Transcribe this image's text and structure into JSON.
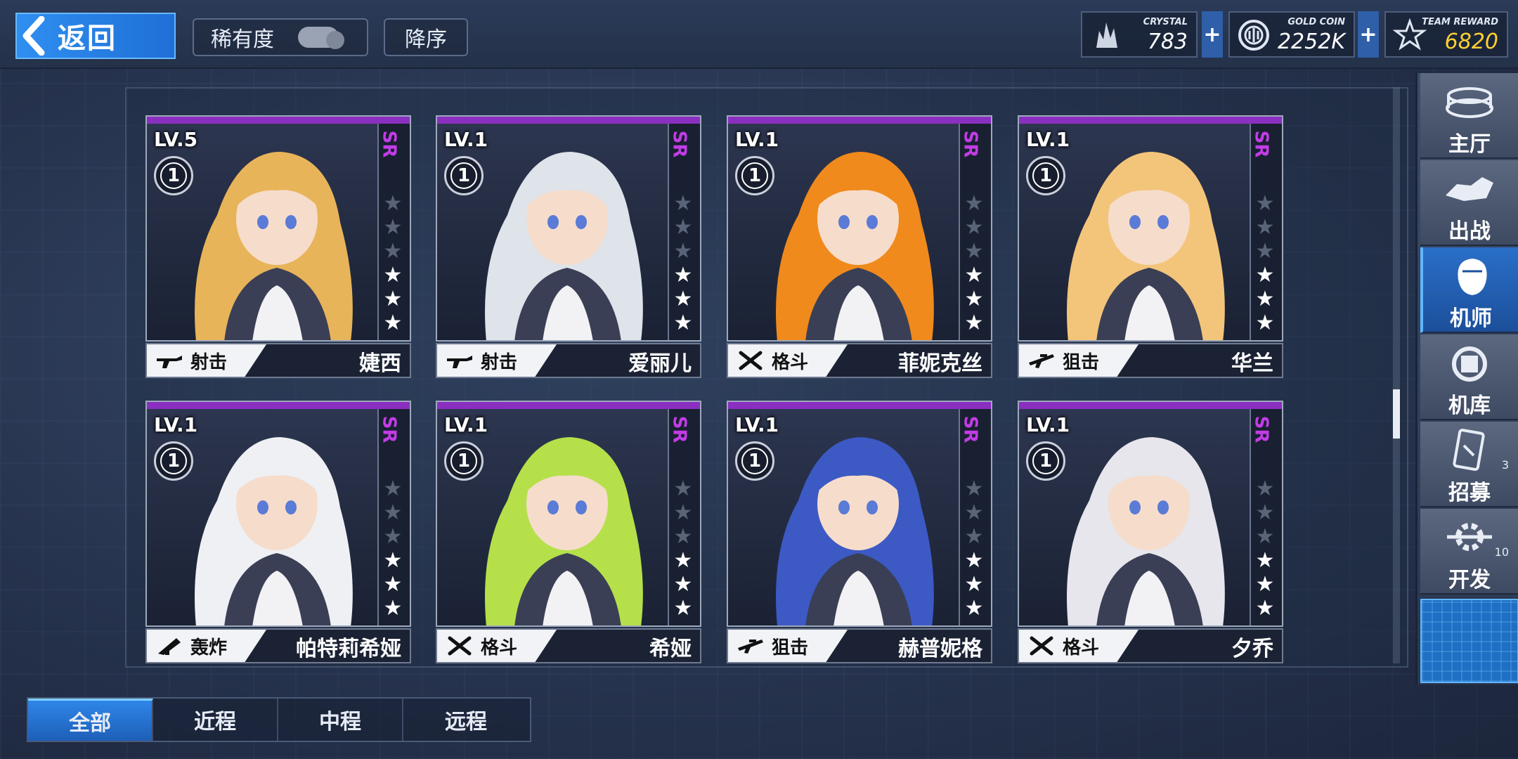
{
  "header": {
    "back_label": "返回",
    "rarity_label": "稀有度",
    "order_label": "降序",
    "resources": [
      {
        "caption": "CRYSTAL",
        "value": "783",
        "icon": "crystal-icon"
      },
      {
        "caption": "GOLD COIN",
        "value": "2252K",
        "icon": "gold-coin-icon"
      },
      {
        "caption": "TEAM REWARD",
        "value": "6820",
        "icon": "team-reward-icon"
      }
    ],
    "plus_label": "+"
  },
  "cards": [
    {
      "level": "LV.5",
      "badge": "1",
      "rarity": "SR",
      "type": "射击",
      "type_icon": "rifle-icon",
      "name": "婕西",
      "stars_total": 6,
      "stars_on": 3,
      "hair": "#e8b45a"
    },
    {
      "level": "LV.1",
      "badge": "1",
      "rarity": "SR",
      "type": "射击",
      "type_icon": "rifle-icon",
      "name": "爱丽儿",
      "stars_total": 6,
      "stars_on": 3,
      "hair": "#dfe3ea"
    },
    {
      "level": "LV.1",
      "badge": "1",
      "rarity": "SR",
      "type": "格斗",
      "type_icon": "crossed-swords-icon",
      "name": "菲妮克丝",
      "stars_total": 6,
      "stars_on": 3,
      "hair": "#f08a1c"
    },
    {
      "level": "LV.1",
      "badge": "1",
      "rarity": "SR",
      "type": "狙击",
      "type_icon": "sniper-rifle-icon",
      "name": "华兰",
      "stars_total": 6,
      "stars_on": 3,
      "hair": "#f3c57a"
    },
    {
      "level": "LV.1",
      "badge": "1",
      "rarity": "SR",
      "type": "轰炸",
      "type_icon": "launcher-icon",
      "name": "帕特莉希娅",
      "stars_total": 6,
      "stars_on": 3,
      "hair": "#eef0f4"
    },
    {
      "level": "LV.1",
      "badge": "1",
      "rarity": "SR",
      "type": "格斗",
      "type_icon": "crossed-swords-icon",
      "name": "希娅",
      "stars_total": 6,
      "stars_on": 3,
      "hair": "#b5e04a"
    },
    {
      "level": "LV.1",
      "badge": "1",
      "rarity": "SR",
      "type": "狙击",
      "type_icon": "sniper-rifle-icon",
      "name": "赫普妮格",
      "stars_total": 6,
      "stars_on": 3,
      "hair": "#3c59c4"
    },
    {
      "level": "LV.1",
      "badge": "1",
      "rarity": "SR",
      "type": "格斗",
      "type_icon": "crossed-swords-icon",
      "name": "夕乔",
      "stars_total": 6,
      "stars_on": 3,
      "hair": "#e6e6ec"
    }
  ],
  "nav": [
    {
      "label": "主厅",
      "icon": "hall-icon",
      "count": ""
    },
    {
      "label": "出战",
      "icon": "sortie-icon",
      "count": ""
    },
    {
      "label": "机师",
      "icon": "pilot-icon",
      "count": "",
      "active": true
    },
    {
      "label": "机库",
      "icon": "hangar-icon",
      "count": ""
    },
    {
      "label": "招募",
      "icon": "recruit-card-icon",
      "count": "3"
    },
    {
      "label": "开发",
      "icon": "develop-gear-icon",
      "count": "10"
    }
  ],
  "filters": [
    "全部",
    "近程",
    "中程",
    "远程"
  ],
  "colors": {
    "accent": "#2f86e8",
    "rarity": "#c23ce6",
    "gold": "#ffcf32",
    "card_top": "#8a2fc0"
  }
}
